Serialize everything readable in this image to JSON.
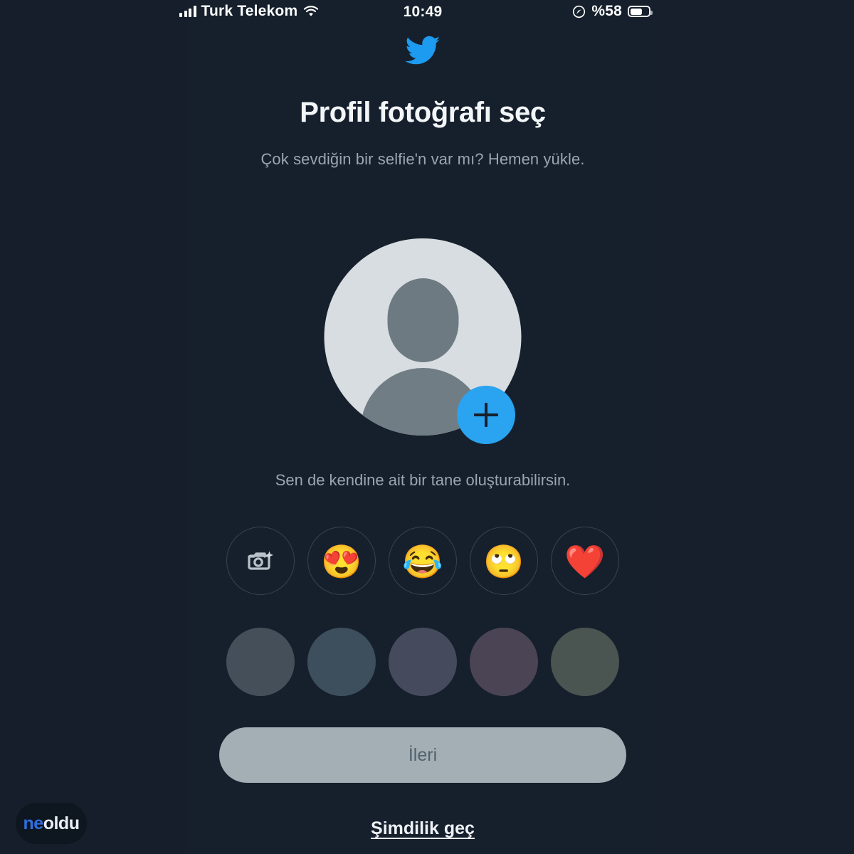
{
  "status_bar": {
    "carrier": "Turk Telekom",
    "time": "10:49",
    "battery_text": "%58",
    "signal_icon": "cellular-signal-icon",
    "wifi_icon": "wifi-icon",
    "location_icon": "location-services-icon",
    "battery_icon": "battery-icon",
    "battery_level_percent": 58
  },
  "brand": {
    "logo_icon": "twitter-bird-logo",
    "logo_color": "#1d9bf0"
  },
  "headline": {
    "title": "Profil fotoğrafı seç",
    "subtitle": "Çok sevdiğin bir selfie'n var mı? Hemen yükle."
  },
  "avatar": {
    "placeholder_icon": "default-avatar-icon",
    "add_button_icon": "plus-icon",
    "add_button_color": "#2aa3f0",
    "circle_color": "#d8dde1",
    "silhouette_color": "#6e7a82",
    "hint": "Sen de kendine ait bir tane oluşturabilirsin."
  },
  "stickers": [
    {
      "name": "camera-sparkle-icon",
      "glyph": "",
      "is_icon": true
    },
    {
      "name": "smiling-face-with-hearts-emoji",
      "glyph": "😍",
      "is_icon": false
    },
    {
      "name": "face-with-tears-of-joy-emoji",
      "glyph": "😂",
      "is_icon": false
    },
    {
      "name": "face-with-rolling-eyes-emoji",
      "glyph": "🙄",
      "is_icon": false
    },
    {
      "name": "red-heart-emoji",
      "glyph": "❤️",
      "is_icon": false
    }
  ],
  "colors": [
    {
      "name": "swatch-slate-gray",
      "hex": "#454f5a"
    },
    {
      "name": "swatch-teal-blue",
      "hex": "#3d4e5c"
    },
    {
      "name": "swatch-blue-gray",
      "hex": "#454b5c"
    },
    {
      "name": "swatch-mauve",
      "hex": "#4a4454"
    },
    {
      "name": "swatch-olive-green",
      "hex": "#4a5450"
    }
  ],
  "actions": {
    "next_label": "İleri",
    "next_enabled": false,
    "skip_label": "Şimdilik geç"
  },
  "watermark": {
    "part_a": "ne",
    "part_b": "oldu"
  }
}
